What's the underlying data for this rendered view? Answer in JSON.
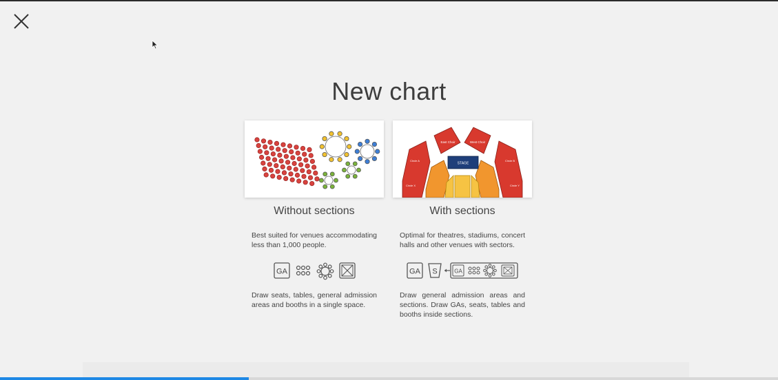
{
  "page": {
    "title": "New chart",
    "close_icon": "close-icon",
    "progress": 0.32
  },
  "options": [
    {
      "title": "Without sections",
      "description": "Best suited for venues accommodating less than 1,000 people.",
      "tools": [
        "GA",
        "table-icon",
        "round-table-icon",
        "booth-icon"
      ],
      "tools_description": "Draw seats, tables, general admission areas and booths in a single space."
    },
    {
      "title": "With sections",
      "description": "Optimal for theatres, stadiums, concert halls and other venues with sectors.",
      "tools": [
        "GA",
        "S",
        "arrow-left-icon",
        "GA",
        "table-icon",
        "round-table-icon",
        "booth-icon"
      ],
      "tools_description": "Draw general admission areas and sections. Draw GAs, seats, tables and booths inside sections.",
      "preview_labels": {
        "stage": "STAGE",
        "east_choir": "East Choir",
        "west_choir": "West Choir",
        "circle_a": "Circle A",
        "circle_b": "Circle B",
        "circle_x": "Circle X",
        "circle_y": "Circle Y"
      }
    }
  ],
  "colors": {
    "accent": "#1e88e5",
    "seat_red": "#d9433f",
    "table_yellow": "#f2c230",
    "table_blue": "#3e7fd6",
    "table_green": "#7bb33b",
    "section_red": "#d8392e",
    "section_orange": "#f1962e",
    "section_yellow": "#f6c343",
    "stage_blue": "#1f3f7a"
  }
}
